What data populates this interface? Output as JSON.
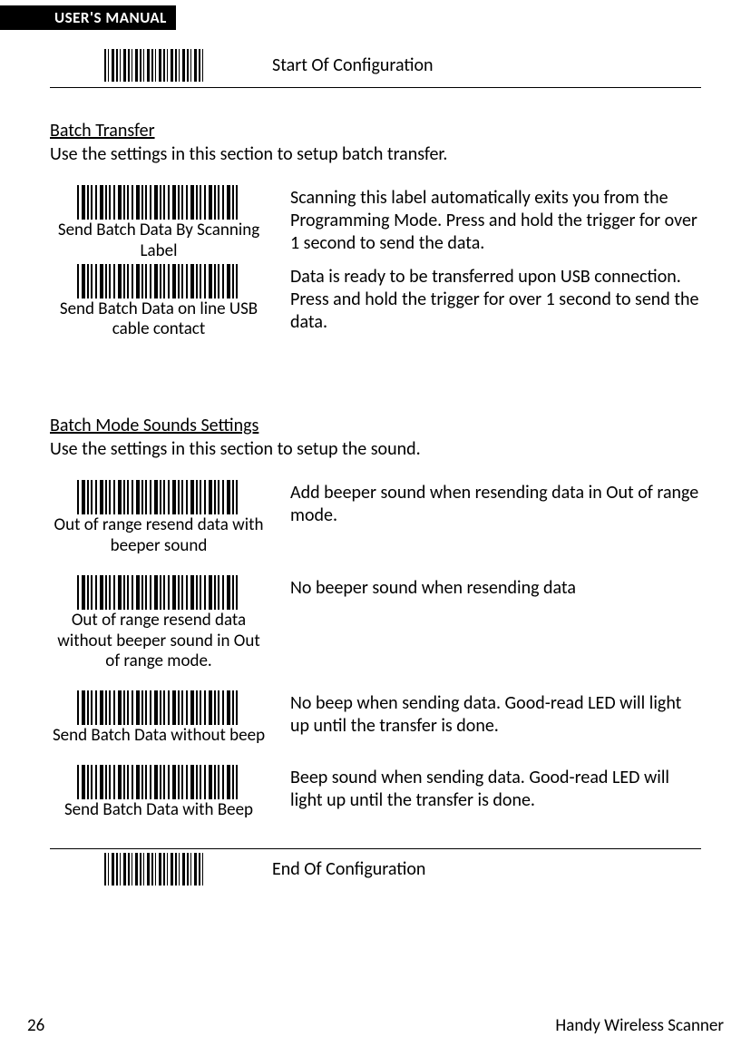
{
  "header": {
    "title": "USER'S MANUAL"
  },
  "config": {
    "start_label": "Start Of Configuration",
    "end_label": "End Of Configuration"
  },
  "sections": {
    "batch_transfer": {
      "title": "Batch Transfer",
      "intro": "Use the settings in this section to setup batch transfer.",
      "items": [
        {
          "label": "Send Batch Data By Scanning Label",
          "desc": "Scanning this label automatically exits you from the Programming Mode. Press and hold the trigger for over 1 second to send the data."
        },
        {
          "label": "Send Batch Data on line USB cable contact",
          "desc": "Data is ready to be transferred upon USB connection. Press and hold the trigger for over 1 second to send the data."
        }
      ]
    },
    "sounds": {
      "title": "Batch Mode Sounds Settings",
      "intro": "Use the settings in this section to setup the sound.",
      "items": [
        {
          "label": "Out of range resend data with beeper sound",
          "desc": "Add beeper sound when resending data in Out of range mode."
        },
        {
          "label": "Out of range resend data without beeper sound in Out of range mode.",
          "desc": "No beeper sound when resending data"
        },
        {
          "label": "Send Batch Data without beep",
          "desc": "No beep when sending data. Good-read LED will light up until the transfer is done."
        },
        {
          "label": "Send Batch Data with Beep",
          "desc": "Beep sound when sending data. Good-read LED will light up until the transfer is done."
        }
      ]
    }
  },
  "footer": {
    "page_number": "26",
    "product_name": "Handy Wireless Scanner"
  }
}
